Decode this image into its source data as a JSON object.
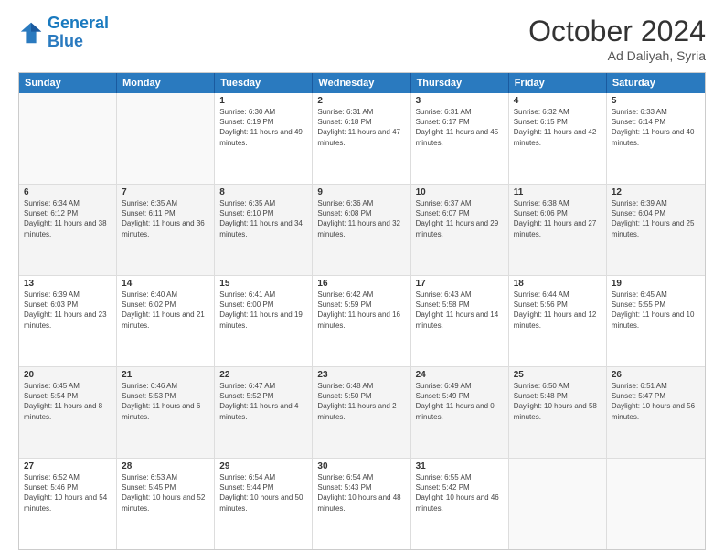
{
  "header": {
    "logo_line1": "General",
    "logo_line2": "Blue",
    "month": "October 2024",
    "location": "Ad Daliyah, Syria"
  },
  "days": [
    "Sunday",
    "Monday",
    "Tuesday",
    "Wednesday",
    "Thursday",
    "Friday",
    "Saturday"
  ],
  "rows": [
    [
      {
        "day": "",
        "sunrise": "",
        "sunset": "",
        "daylight": "",
        "empty": true
      },
      {
        "day": "",
        "sunrise": "",
        "sunset": "",
        "daylight": "",
        "empty": true
      },
      {
        "day": "1",
        "sunrise": "Sunrise: 6:30 AM",
        "sunset": "Sunset: 6:19 PM",
        "daylight": "Daylight: 11 hours and 49 minutes."
      },
      {
        "day": "2",
        "sunrise": "Sunrise: 6:31 AM",
        "sunset": "Sunset: 6:18 PM",
        "daylight": "Daylight: 11 hours and 47 minutes."
      },
      {
        "day": "3",
        "sunrise": "Sunrise: 6:31 AM",
        "sunset": "Sunset: 6:17 PM",
        "daylight": "Daylight: 11 hours and 45 minutes."
      },
      {
        "day": "4",
        "sunrise": "Sunrise: 6:32 AM",
        "sunset": "Sunset: 6:15 PM",
        "daylight": "Daylight: 11 hours and 42 minutes."
      },
      {
        "day": "5",
        "sunrise": "Sunrise: 6:33 AM",
        "sunset": "Sunset: 6:14 PM",
        "daylight": "Daylight: 11 hours and 40 minutes."
      }
    ],
    [
      {
        "day": "6",
        "sunrise": "Sunrise: 6:34 AM",
        "sunset": "Sunset: 6:12 PM",
        "daylight": "Daylight: 11 hours and 38 minutes."
      },
      {
        "day": "7",
        "sunrise": "Sunrise: 6:35 AM",
        "sunset": "Sunset: 6:11 PM",
        "daylight": "Daylight: 11 hours and 36 minutes."
      },
      {
        "day": "8",
        "sunrise": "Sunrise: 6:35 AM",
        "sunset": "Sunset: 6:10 PM",
        "daylight": "Daylight: 11 hours and 34 minutes."
      },
      {
        "day": "9",
        "sunrise": "Sunrise: 6:36 AM",
        "sunset": "Sunset: 6:08 PM",
        "daylight": "Daylight: 11 hours and 32 minutes."
      },
      {
        "day": "10",
        "sunrise": "Sunrise: 6:37 AM",
        "sunset": "Sunset: 6:07 PM",
        "daylight": "Daylight: 11 hours and 29 minutes."
      },
      {
        "day": "11",
        "sunrise": "Sunrise: 6:38 AM",
        "sunset": "Sunset: 6:06 PM",
        "daylight": "Daylight: 11 hours and 27 minutes."
      },
      {
        "day": "12",
        "sunrise": "Sunrise: 6:39 AM",
        "sunset": "Sunset: 6:04 PM",
        "daylight": "Daylight: 11 hours and 25 minutes."
      }
    ],
    [
      {
        "day": "13",
        "sunrise": "Sunrise: 6:39 AM",
        "sunset": "Sunset: 6:03 PM",
        "daylight": "Daylight: 11 hours and 23 minutes."
      },
      {
        "day": "14",
        "sunrise": "Sunrise: 6:40 AM",
        "sunset": "Sunset: 6:02 PM",
        "daylight": "Daylight: 11 hours and 21 minutes."
      },
      {
        "day": "15",
        "sunrise": "Sunrise: 6:41 AM",
        "sunset": "Sunset: 6:00 PM",
        "daylight": "Daylight: 11 hours and 19 minutes."
      },
      {
        "day": "16",
        "sunrise": "Sunrise: 6:42 AM",
        "sunset": "Sunset: 5:59 PM",
        "daylight": "Daylight: 11 hours and 16 minutes."
      },
      {
        "day": "17",
        "sunrise": "Sunrise: 6:43 AM",
        "sunset": "Sunset: 5:58 PM",
        "daylight": "Daylight: 11 hours and 14 minutes."
      },
      {
        "day": "18",
        "sunrise": "Sunrise: 6:44 AM",
        "sunset": "Sunset: 5:56 PM",
        "daylight": "Daylight: 11 hours and 12 minutes."
      },
      {
        "day": "19",
        "sunrise": "Sunrise: 6:45 AM",
        "sunset": "Sunset: 5:55 PM",
        "daylight": "Daylight: 11 hours and 10 minutes."
      }
    ],
    [
      {
        "day": "20",
        "sunrise": "Sunrise: 6:45 AM",
        "sunset": "Sunset: 5:54 PM",
        "daylight": "Daylight: 11 hours and 8 minutes."
      },
      {
        "day": "21",
        "sunrise": "Sunrise: 6:46 AM",
        "sunset": "Sunset: 5:53 PM",
        "daylight": "Daylight: 11 hours and 6 minutes."
      },
      {
        "day": "22",
        "sunrise": "Sunrise: 6:47 AM",
        "sunset": "Sunset: 5:52 PM",
        "daylight": "Daylight: 11 hours and 4 minutes."
      },
      {
        "day": "23",
        "sunrise": "Sunrise: 6:48 AM",
        "sunset": "Sunset: 5:50 PM",
        "daylight": "Daylight: 11 hours and 2 minutes."
      },
      {
        "day": "24",
        "sunrise": "Sunrise: 6:49 AM",
        "sunset": "Sunset: 5:49 PM",
        "daylight": "Daylight: 11 hours and 0 minutes."
      },
      {
        "day": "25",
        "sunrise": "Sunrise: 6:50 AM",
        "sunset": "Sunset: 5:48 PM",
        "daylight": "Daylight: 10 hours and 58 minutes."
      },
      {
        "day": "26",
        "sunrise": "Sunrise: 6:51 AM",
        "sunset": "Sunset: 5:47 PM",
        "daylight": "Daylight: 10 hours and 56 minutes."
      }
    ],
    [
      {
        "day": "27",
        "sunrise": "Sunrise: 6:52 AM",
        "sunset": "Sunset: 5:46 PM",
        "daylight": "Daylight: 10 hours and 54 minutes."
      },
      {
        "day": "28",
        "sunrise": "Sunrise: 6:53 AM",
        "sunset": "Sunset: 5:45 PM",
        "daylight": "Daylight: 10 hours and 52 minutes."
      },
      {
        "day": "29",
        "sunrise": "Sunrise: 6:54 AM",
        "sunset": "Sunset: 5:44 PM",
        "daylight": "Daylight: 10 hours and 50 minutes."
      },
      {
        "day": "30",
        "sunrise": "Sunrise: 6:54 AM",
        "sunset": "Sunset: 5:43 PM",
        "daylight": "Daylight: 10 hours and 48 minutes."
      },
      {
        "day": "31",
        "sunrise": "Sunrise: 6:55 AM",
        "sunset": "Sunset: 5:42 PM",
        "daylight": "Daylight: 10 hours and 46 minutes."
      },
      {
        "day": "",
        "sunrise": "",
        "sunset": "",
        "daylight": "",
        "empty": true
      },
      {
        "day": "",
        "sunrise": "",
        "sunset": "",
        "daylight": "",
        "empty": true
      }
    ]
  ]
}
